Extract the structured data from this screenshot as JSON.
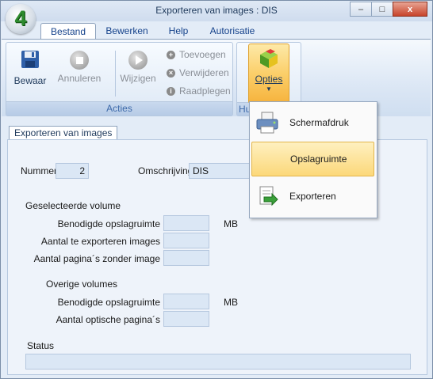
{
  "window": {
    "title": "Exporteren van images : DIS",
    "app_logo": "4",
    "controls": {
      "minimize": "–",
      "maximize": "□",
      "close": "x"
    }
  },
  "tabs": [
    "Bestand",
    "Bewerken",
    "Help",
    "Autorisatie"
  ],
  "ribbon": {
    "acties_group": "Acties",
    "hulp_group_partial": "Hu",
    "buttons": {
      "bewaar": "Bewaar",
      "annuleren": "Annuleren",
      "wijzigen": "Wijzigen",
      "toevoegen": "Toevoegen",
      "verwijderen": "Verwijderen",
      "raadplegen": "Raadplegen",
      "opties": "Opties"
    }
  },
  "menu": {
    "items": [
      "Schermafdruk",
      "Opslagruimte",
      "Exporteren"
    ]
  },
  "form": {
    "tab_label": "Exporteren van images",
    "nummer_label": "Nummer",
    "nummer_value": "2",
    "omschrijving_label": "Omschrijving",
    "omschrijving_value": "DIS",
    "geselecteerde_volume_label": "Geselecteerde volume",
    "benodigde_opslagruimte_label": "Benodigde opslagruimte",
    "benodigde_opslagruimte_value": "",
    "unit_mb": "MB",
    "aantal_te_exporteren_label": "Aantal te exporteren images",
    "aantal_te_exporteren_value": "",
    "aantal_paginas_zonder_label": "Aantal pagina´s zonder image",
    "aantal_paginas_zonder_value": "",
    "overige_volumes_label": "Overige volumes",
    "overige_benodigde_label": "Benodigde opslagruimte",
    "overige_benodigde_value": "",
    "aantal_optische_label": "Aantal optische pagina´s",
    "aantal_optische_value": "",
    "status_label": "Status",
    "status_value": ""
  },
  "colors": {
    "accent": "#15428b",
    "ribbon_highlight": "#fbcf6a",
    "field_bg": "#dbe7f5"
  }
}
